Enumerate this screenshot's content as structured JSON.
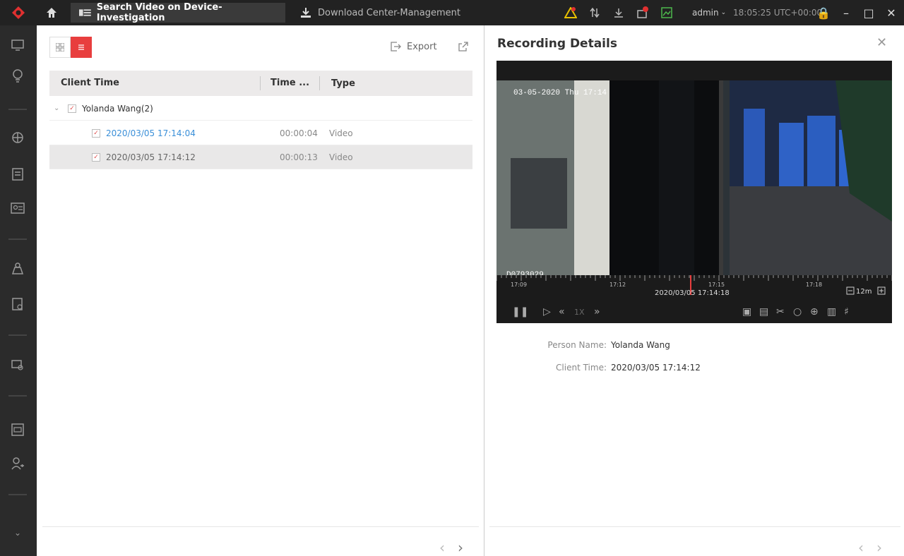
{
  "titlebar": {
    "tabs": [
      {
        "label": "Search Video on Device-Investigation"
      },
      {
        "label": "Download Center-Management"
      }
    ],
    "user": "admin",
    "clock": "18:05:25 UTC+00:00"
  },
  "left": {
    "export_label": "Export",
    "columns": [
      "Client Time",
      "Time ...",
      "Type"
    ],
    "group": {
      "label": "Yolanda Wang(2)"
    },
    "rows": [
      {
        "time": "2020/03/05 17:14:04",
        "duration": "00:00:04",
        "type": "Video"
      },
      {
        "time": "2020/03/05 17:14:12",
        "duration": "00:00:13",
        "type": "Video"
      }
    ]
  },
  "right": {
    "title": "Recording Details",
    "osd": {
      "date": "03-05-2020 Thu 17:14",
      "camid": "D0793029"
    },
    "timeline": {
      "ticks": [
        "17:09",
        "17:12",
        "17:15",
        "17:18"
      ],
      "current": "2020/03/05 17:14:18",
      "zoom": "12m"
    },
    "controls": {
      "speed": "1X"
    },
    "details": {
      "person_label": "Person Name:",
      "person_value": "Yolanda Wang",
      "time_label": "Client Time:",
      "time_value": "2020/03/05 17:14:12"
    }
  },
  "colors": {
    "accent": "#e83e3e",
    "link": "#3a8fd8",
    "titlebar": "#222222",
    "rail": "#2b2b2b"
  }
}
